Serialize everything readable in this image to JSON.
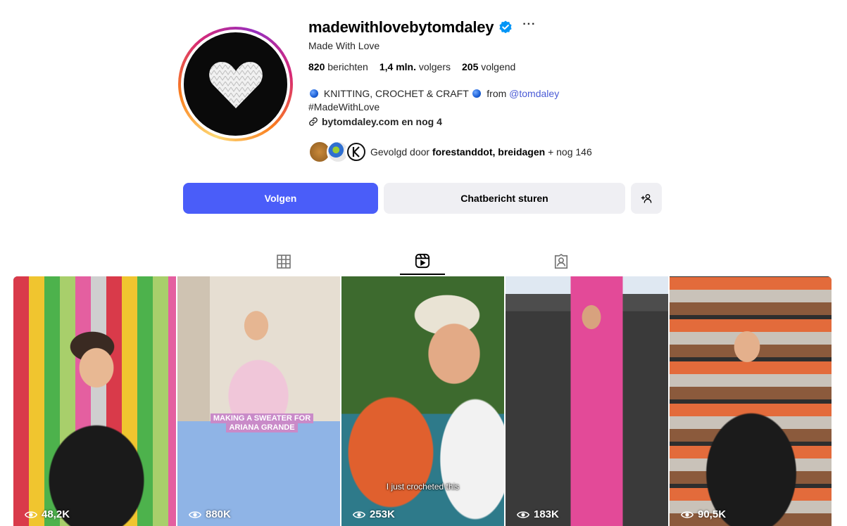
{
  "profile": {
    "username": "madewithlovebytomdaley",
    "more_label": "···",
    "full_name": "Made With Love",
    "stats": {
      "posts_value": "820",
      "posts_label": "berichten",
      "followers_value": "1,4 mln.",
      "followers_label": "volgers",
      "following_value": "205",
      "following_label": "volgend"
    },
    "bio": {
      "line1_text": "KNITTING, CROCHET & CRAFT",
      "line1_from": "from",
      "line1_mention": "@tomdaley",
      "line2": "#MadeWithLove"
    },
    "link_text": "bytomdaley.com en nog 4",
    "followed_by": {
      "prefix": "Gevolgd door",
      "names": "forestanddot, breidagen",
      "suffix": "+ nog 146"
    }
  },
  "actions": {
    "follow_label": "Volgen",
    "message_label": "Chatbericht sturen"
  },
  "tabs": [
    {
      "icon": "grid-icon",
      "active": false
    },
    {
      "icon": "reels-icon",
      "active": true
    },
    {
      "icon": "tagged-icon",
      "active": false
    }
  ],
  "reels": [
    {
      "views": "48,2K"
    },
    {
      "views": "880K",
      "caption": "MAKING A SWEATER FOR ARIANA GRANDE"
    },
    {
      "views": "253K",
      "subtitle": "I just crocheted this"
    },
    {
      "views": "183K"
    },
    {
      "views": "90,5K"
    }
  ],
  "colors": {
    "follow_button": "#4a5df9",
    "secondary_button": "#efeff3",
    "verified_badge": "#0095f6",
    "mention_link": "#4a5bd6"
  }
}
